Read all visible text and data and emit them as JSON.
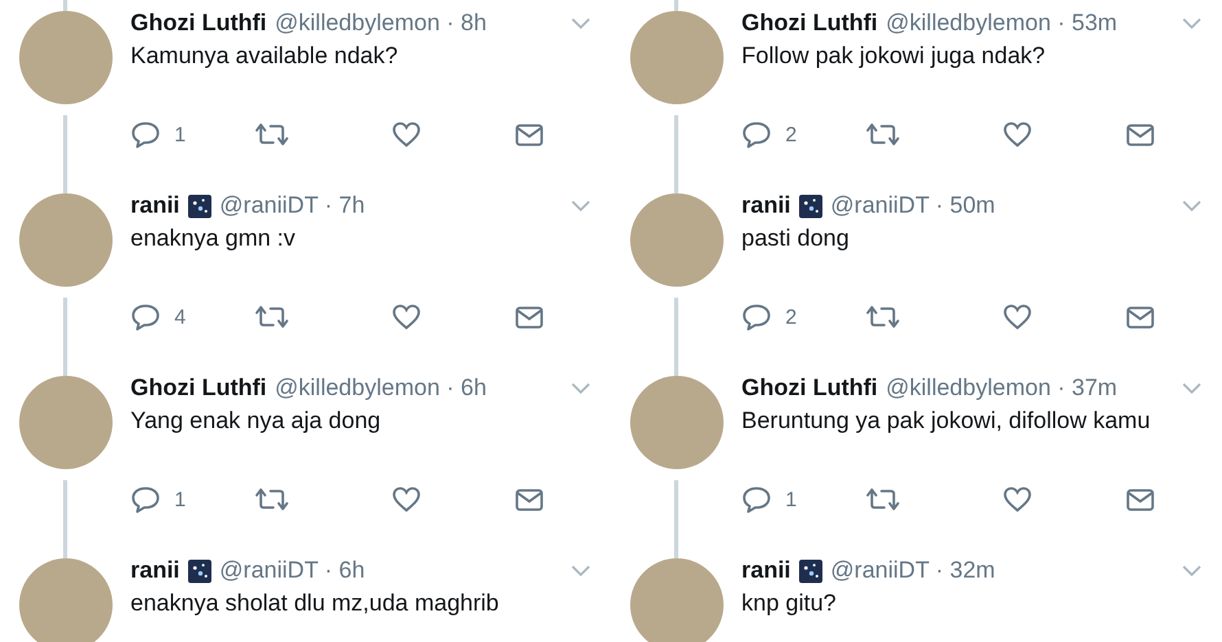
{
  "columns": [
    {
      "tweets": [
        {
          "name": "Ghozi Luthfi",
          "handle": "@killedbylemon",
          "time": "· 8h",
          "text": "Kamunya available ndak?",
          "actions": {
            "replies": "1"
          }
        },
        {
          "name": "ranii",
          "handle": "@raniiDT",
          "time": "· 7h",
          "text": "enaknya gmn :v",
          "emoji_badge": true,
          "actions": {
            "replies": "4"
          }
        },
        {
          "name": "Ghozi Luthfi",
          "handle": "@killedbylemon",
          "time": "· 6h",
          "text": "Yang enak nya aja dong",
          "actions": {
            "replies": "1"
          }
        },
        {
          "name": "ranii",
          "handle": "@raniiDT",
          "time": "· 6h",
          "text": "enaknya sholat dlu mz,uda maghrib",
          "emoji_badge": true
        }
      ]
    },
    {
      "tweets": [
        {
          "name": "Ghozi Luthfi",
          "handle": "@killedbylemon",
          "time": "· 53m",
          "text": "Follow pak jokowi juga ndak?",
          "actions": {
            "replies": "2"
          }
        },
        {
          "name": "ranii",
          "handle": "@raniiDT",
          "time": "· 50m",
          "text": "pasti dong",
          "emoji_badge": true,
          "actions": {
            "replies": "2"
          }
        },
        {
          "name": "Ghozi Luthfi",
          "handle": "@killedbylemon",
          "time": "· 37m",
          "text": "Beruntung ya pak jokowi, difollow kamu",
          "actions": {
            "replies": "1"
          }
        },
        {
          "name": "ranii",
          "handle": "@raniiDT",
          "time": "· 32m",
          "text": "knp gitu?",
          "emoji_badge": true
        }
      ]
    }
  ]
}
